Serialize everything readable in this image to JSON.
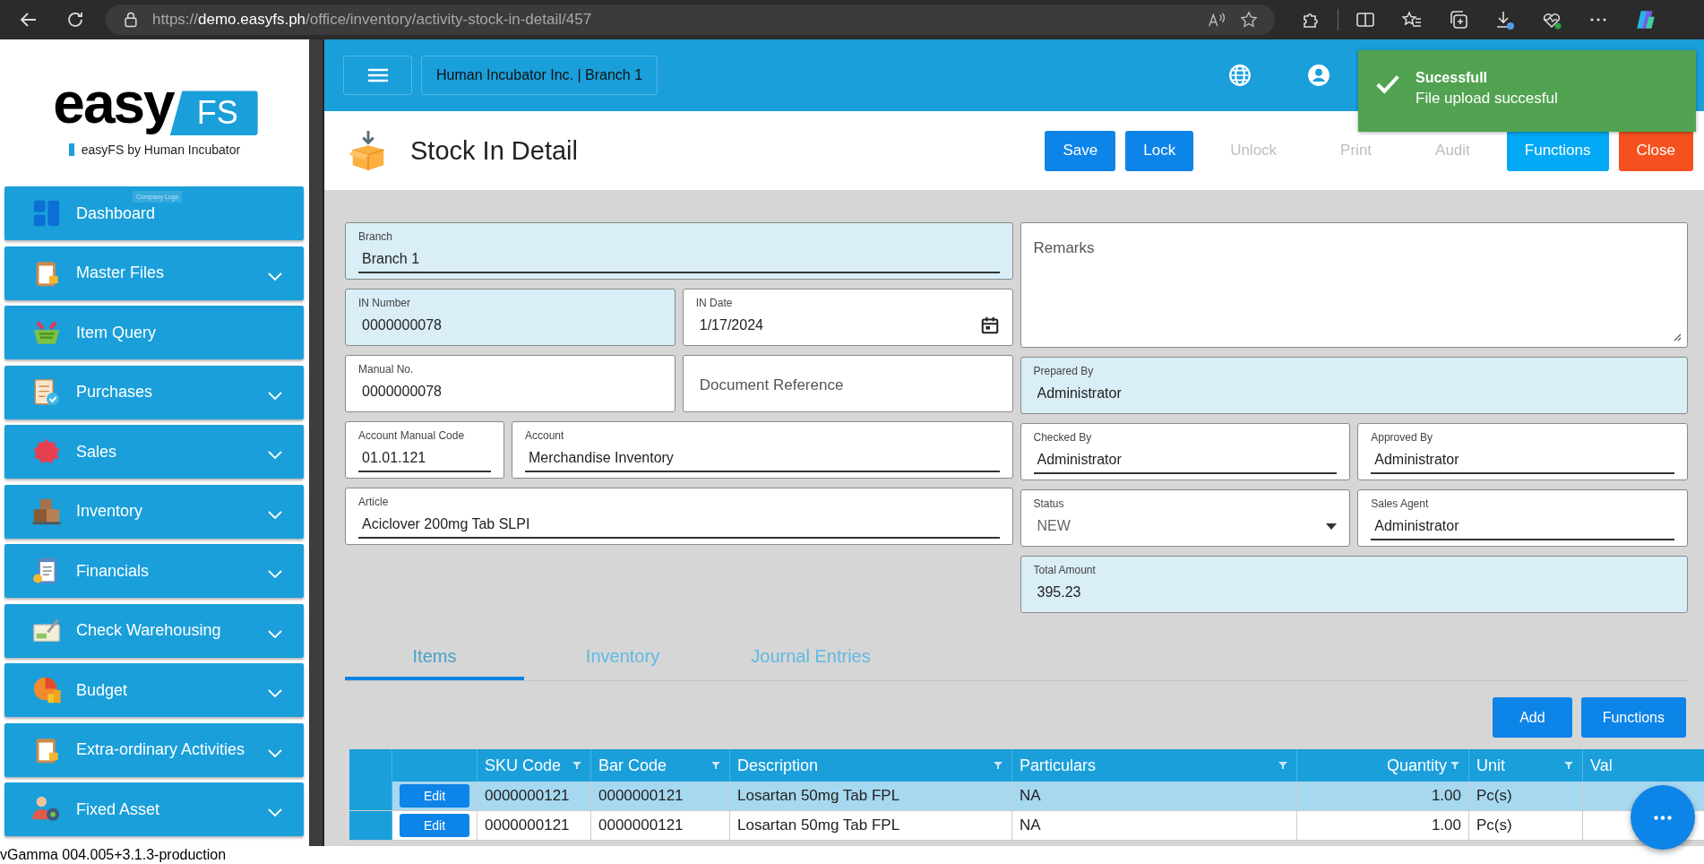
{
  "browser": {
    "url_scheme": "https://",
    "url_host": "demo.easyfs.ph",
    "url_path": "/office/inventory/activity-stock-in-detail/457"
  },
  "sidebar": {
    "logo": {
      "word": "easy",
      "badge": "FS",
      "tagline": "easyFS by Human Incubator",
      "caption": "Company Logo"
    },
    "items": [
      {
        "label": "Dashboard",
        "expandable": false
      },
      {
        "label": "Master Files",
        "expandable": true
      },
      {
        "label": "Item Query",
        "expandable": false
      },
      {
        "label": "Purchases",
        "expandable": true
      },
      {
        "label": "Sales",
        "expandable": true
      },
      {
        "label": "Inventory",
        "expandable": true
      },
      {
        "label": "Financials",
        "expandable": true
      },
      {
        "label": "Check Warehousing",
        "expandable": true
      },
      {
        "label": "Budget",
        "expandable": true
      },
      {
        "label": "Extra-ordinary Activities",
        "expandable": true
      },
      {
        "label": "Fixed Asset",
        "expandable": true
      }
    ]
  },
  "topbar": {
    "company": "Human Incubator Inc. | Branch 1"
  },
  "toast": {
    "title": "Sucessfull",
    "message": "File upload succesful"
  },
  "page": {
    "title": "Stock In Detail",
    "buttons": [
      {
        "label": "Save",
        "kind": "primary",
        "disabled": false
      },
      {
        "label": "Lock",
        "kind": "primary",
        "disabled": false
      },
      {
        "label": "Unlock",
        "disabled": true
      },
      {
        "label": "Print",
        "disabled": true
      },
      {
        "label": "Audit",
        "disabled": true
      },
      {
        "label": "Functions",
        "kind": "info",
        "disabled": false
      },
      {
        "label": "Close",
        "kind": "danger",
        "disabled": false
      }
    ]
  },
  "form": {
    "left_rows": [
      [
        {
          "kind": "text",
          "label": "Branch",
          "value": "Branch 1",
          "readonly": true,
          "underlined": true
        }
      ],
      [
        {
          "kind": "text",
          "label": "IN Number",
          "value": "0000000078",
          "readonly": true,
          "underlined": false
        },
        {
          "kind": "date",
          "label": "IN Date",
          "value": "1/17/2024",
          "readonly": false,
          "underlined": false
        }
      ],
      [
        {
          "kind": "text",
          "label": "Manual No.",
          "value": "0000000078",
          "readonly": false,
          "underlined": false
        },
        {
          "kind": "text",
          "placeholder": "Document Reference",
          "readonly": false,
          "underlined": false
        }
      ],
      [
        {
          "kind": "text",
          "label": "Account Manual Code",
          "value": "01.01.121",
          "readonly": false,
          "underlined": true
        },
        {
          "kind": "text",
          "label": "Account",
          "value": "Merchandise Inventory",
          "readonly": false,
          "underlined": true
        }
      ],
      [
        {
          "kind": "text",
          "label": "Article",
          "value": "Aciclover 200mg Tab SLPI",
          "readonly": false,
          "underlined": true
        }
      ]
    ],
    "right_rows": [
      [
        {
          "kind": "textarea",
          "placeholder": "Remarks",
          "readonly": false
        }
      ],
      [
        {
          "kind": "text",
          "label": "Prepared By",
          "value": "Administrator",
          "readonly": true,
          "underlined": false
        }
      ],
      [
        {
          "kind": "text",
          "label": "Checked By",
          "value": "Administrator",
          "readonly": false,
          "underlined": true
        },
        {
          "kind": "text",
          "label": "Approved By",
          "value": "Administrator",
          "readonly": false,
          "underlined": true
        }
      ],
      [
        {
          "kind": "select",
          "label": "Status",
          "value": "NEW",
          "readonly": false,
          "underlined": false
        },
        {
          "kind": "text",
          "label": "Sales Agent",
          "value": "Administrator",
          "readonly": false,
          "underlined": true
        }
      ],
      [
        {
          "kind": "text",
          "label": "Total Amount",
          "value": "395.23",
          "readonly": true,
          "underlined": false
        }
      ]
    ]
  },
  "tabs": [
    {
      "label": "Items",
      "selected": true
    },
    {
      "label": "Inventory",
      "selected": false
    },
    {
      "label": "Journal Entries",
      "selected": false
    }
  ],
  "table_buttons": [
    "Add",
    "Functions"
  ],
  "table": {
    "columns": [
      {
        "label": "SKU Code",
        "filter": true,
        "numeric": false
      },
      {
        "label": "Bar Code",
        "filter": true,
        "numeric": false
      },
      {
        "label": "Description",
        "filter": true,
        "numeric": false
      },
      {
        "label": "Particulars",
        "filter": true,
        "numeric": false
      },
      {
        "label": "Quantity",
        "filter": true,
        "numeric": true
      },
      {
        "label": "Unit",
        "filter": true,
        "numeric": false
      },
      {
        "label": "Val",
        "filter": false,
        "numeric": false
      }
    ],
    "rows": [
      {
        "selected": true,
        "action": "Edit",
        "cells": [
          "0000000121",
          "0000000121",
          "Losartan 50mg Tab FPL",
          "NA",
          "1.00",
          "Pc(s)"
        ]
      },
      {
        "selected": false,
        "action": "Edit",
        "cells": [
          "0000000121",
          "0000000121",
          "Losartan 50mg Tab FPL",
          "NA",
          "1.00",
          "Pc(s)"
        ]
      }
    ]
  },
  "footer": "vGamma 004.005+3.1.3-production"
}
